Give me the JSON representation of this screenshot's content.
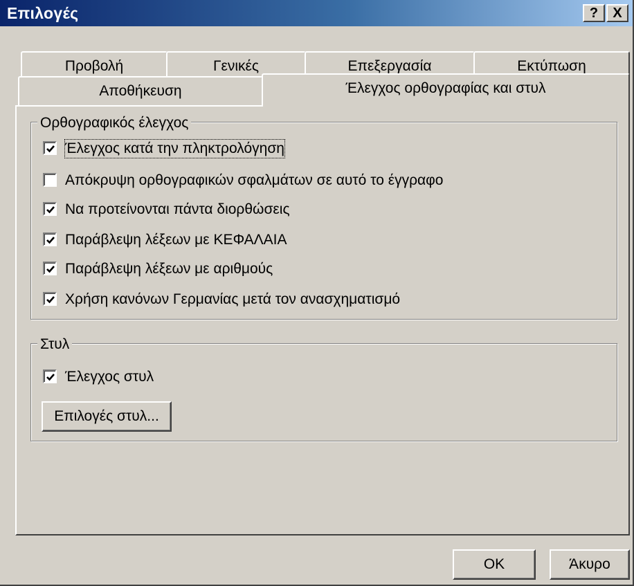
{
  "window": {
    "title": "Επιλογές",
    "help_glyph": "?",
    "close_glyph": "X"
  },
  "tabs_row1": [
    "Προβολή",
    "Γενικές",
    "Επεξεργασία",
    "Εκτύπωση"
  ],
  "tabs_row2": {
    "save": "Αποθήκευση",
    "active": "Έλεγχος ορθογραφίας και στυλ"
  },
  "spelling_group": {
    "legend": "Ορθογραφικός έλεγχος",
    "items": [
      {
        "label": "Έλεγχος κατά την πληκτρολόγηση",
        "checked": true
      },
      {
        "label": "Απόκρυψη ορθογραφικών σφαλμάτων σε αυτό το έγγραφο",
        "checked": false
      },
      {
        "label": "Να προτείνονται πάντα διορθώσεις",
        "checked": true
      },
      {
        "label": "Παράβλεψη λέξεων με ΚΕΦΑΛΑΙΑ",
        "checked": true
      },
      {
        "label": "Παράβλεψη λέξεων με αριθμούς",
        "checked": true
      },
      {
        "label": "Χρήση κανόνων Γερμανίας μετά τον ανασχηματισμό",
        "checked": true
      }
    ]
  },
  "style_group": {
    "legend": "Στυλ",
    "check_label": "Έλεγχος στυλ",
    "checked": true,
    "options_button": "Επιλογές στυλ..."
  },
  "buttons": {
    "ok": "OK",
    "cancel": "Άκυρο"
  }
}
